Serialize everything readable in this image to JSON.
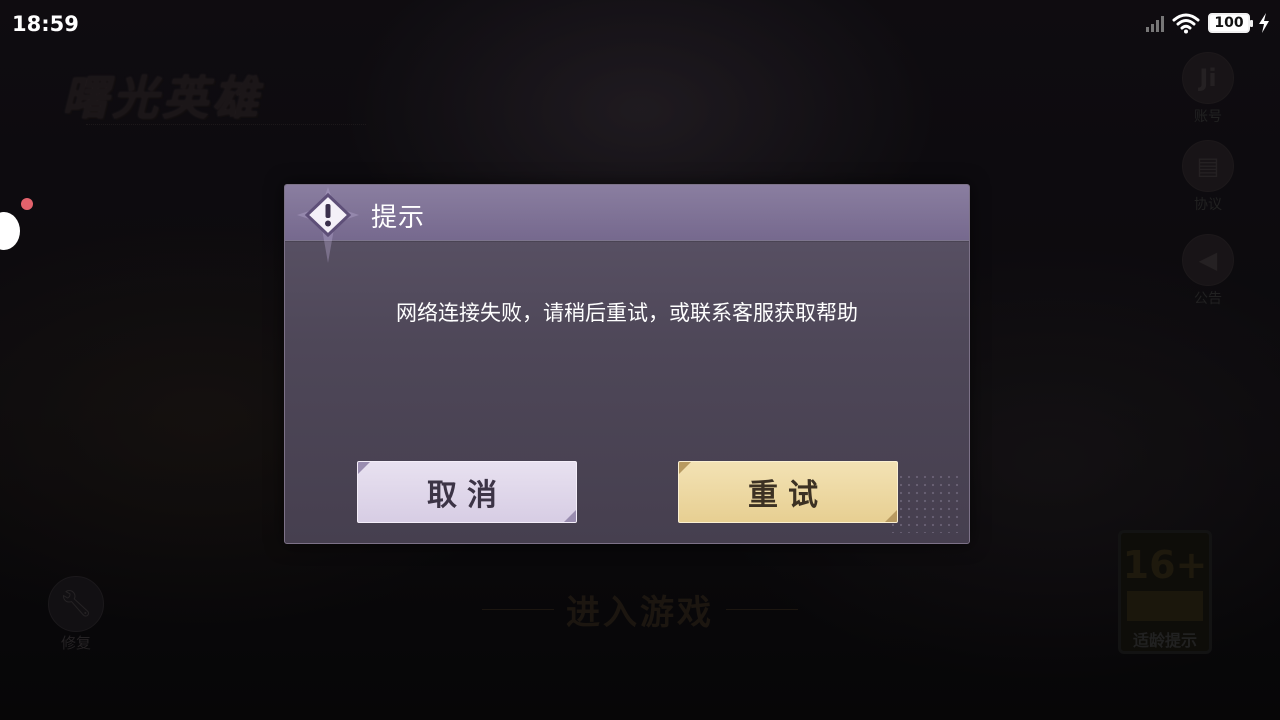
{
  "status_bar": {
    "time": "18:59",
    "battery": "100",
    "signal_icon": "signal-bars-icon",
    "wifi_icon": "wifi-icon",
    "charging_icon": "lightning-bolt-icon"
  },
  "background": {
    "game_logo": "曙光英雄",
    "side_menu": [
      {
        "label": "账号",
        "icon": "account-icon",
        "glyph": "Ji"
      },
      {
        "label": "协议",
        "icon": "agreement-icon",
        "glyph": "▤"
      },
      {
        "label": "公告",
        "icon": "announcement-megaphone-icon",
        "glyph": "◀"
      }
    ],
    "repair_label": "修复",
    "enter_game_label": "进入游戏",
    "age_rating": {
      "number": "16+",
      "label": "适龄提示"
    }
  },
  "dialog": {
    "title": "提示",
    "icon": "warning-exclamation-icon",
    "message": "网络连接失败，请稍后重试，或联系客服获取帮助",
    "cancel_label": "取消",
    "retry_label": "重试"
  },
  "colors": {
    "dialog_header": "#76698e",
    "dialog_body": "#4e4758",
    "cancel_button": "#e0d7ea",
    "retry_button": "#edd8a3",
    "notification_dot": "#e2626c"
  }
}
